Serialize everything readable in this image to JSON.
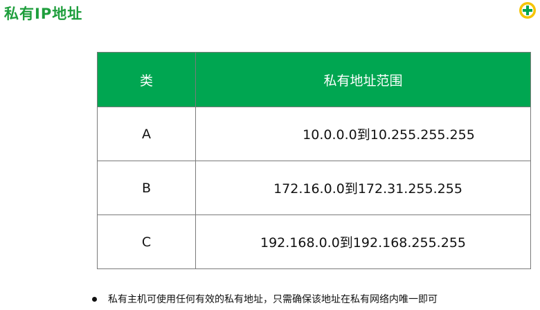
{
  "title": "私有IP地址",
  "logo": {
    "icon": "logo-badge-icon",
    "primary_color": "#00a651",
    "accent_color": "#f5c400"
  },
  "table": {
    "headers": [
      "类",
      "私有地址范围"
    ],
    "rows": [
      {
        "class": "A",
        "range": "10.0.0.0到10.255.255.255"
      },
      {
        "class": "B",
        "range": "172.16.0.0到172.31.255.255"
      },
      {
        "class": "C",
        "range": "192.168.0.0到192.168.255.255"
      }
    ]
  },
  "bullet": "私有主机可使用任何有效的私有地址，只需确保该地址在私有网络内唯一即可",
  "colors": {
    "title": "#1e9e3c",
    "header_bg": "#00a651",
    "header_text": "#ffffff"
  }
}
